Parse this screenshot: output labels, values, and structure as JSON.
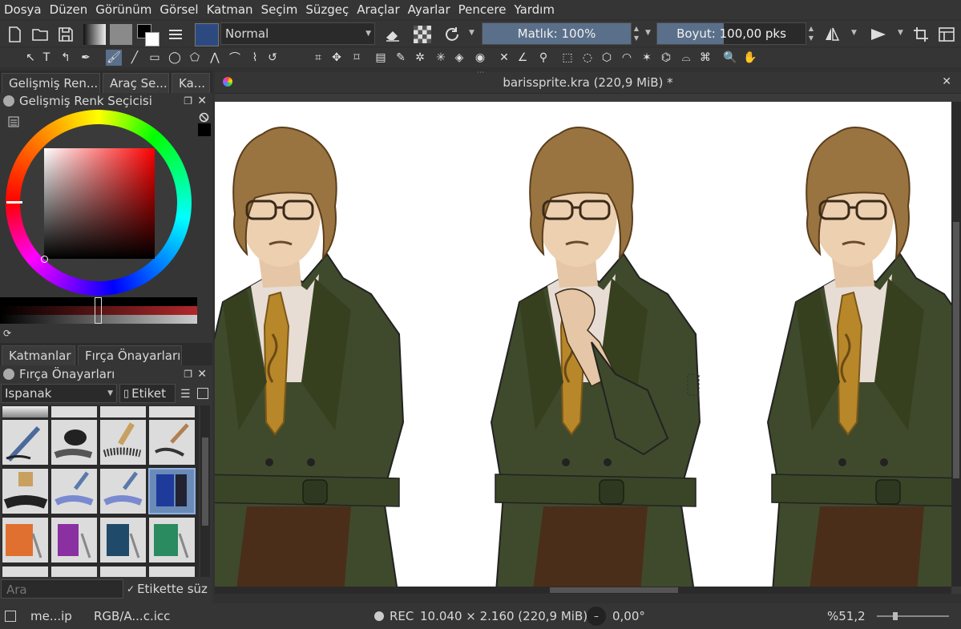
{
  "menu": [
    "Dosya",
    "Düzen",
    "Görünüm",
    "Görsel",
    "Katman",
    "Seçim",
    "Süzgeç",
    "Araçlar",
    "Ayarlar",
    "Pencere",
    "Yardım"
  ],
  "toolbar": {
    "blend_mode": "Normal",
    "opacity_label": "Matlık: 100%",
    "opacity_fraction": 1.0,
    "size_label": "Boyut: 100,00 pks",
    "size_fraction": 0.45
  },
  "docker_tabs_top": [
    "Gelişmiş Ren...",
    "Araç Se...",
    "Ka..."
  ],
  "color_selector": {
    "title": "Gelişmiş Renk Seçicisi",
    "current_color": "#b0282a"
  },
  "docker_tabs_bottom": [
    "Katmanlar",
    "Fırça Önayarları"
  ],
  "brush_presets": {
    "title": "Fırça Önayarları",
    "filter_value": "Ispanak",
    "tag_button": "Etiket",
    "search_placeholder": "Ara",
    "filter_tag_checkbox": "Etikette süz",
    "filter_tag_checked": true
  },
  "document": {
    "tab_title": "barissprite.kra (220,9 MiB) *"
  },
  "status": {
    "brush_name": "me...ip",
    "color_profile": "RGB/A...c.icc",
    "rec": "REC",
    "dimensions": "10.040 × 2.160 (220,9 MiB)",
    "rotation": "0,00°",
    "zoom": "%51,2"
  },
  "colors": {
    "accent": "#5a6f8a",
    "panel": "#353535",
    "jacket": "#3f4a2c",
    "hair": "#9a7440",
    "tie": "#b8872a"
  }
}
